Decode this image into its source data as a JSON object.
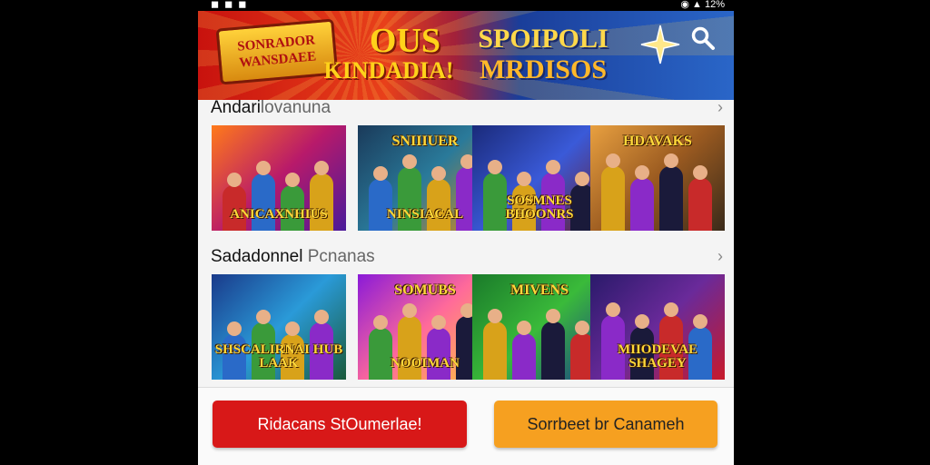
{
  "status_bar": {
    "right_text": "12%"
  },
  "banner": {
    "left_title": "SONRADOR WANSDAEE",
    "mid_title_1": "OUS",
    "mid_title_2": "KINDADIA!",
    "right_title_1": "SPOIPOLI",
    "right_title_2": "MRDISOS"
  },
  "sections": [
    {
      "title_main": "Andari",
      "title_light": "lovanuna",
      "tiles": [
        {
          "top": "",
          "bottom": "ANICAXNHIUS",
          "bg": "linear-gradient(135deg,#ff7a1a,#b81a6a 50%,#4a1a9a)"
        },
        {
          "top": "SNIIIUER",
          "bottom": "NINSIACAL",
          "bg": "linear-gradient(135deg,#1a3a5a,#2a7a9a 50%,#d88a1a)"
        },
        {
          "top": "",
          "bottom": "SOSMNES BHOONRS",
          "bg": "linear-gradient(135deg,#1a2a7a,#3a5ad8 50%,#6a1a2a)"
        },
        {
          "top": "HDAVAKS",
          "bottom": "",
          "bg": "linear-gradient(135deg,#e8a040,#9a5a20 50%,#3a2a1a)"
        }
      ]
    },
    {
      "title_main": "Sadadonnel",
      "title_light": "Pcnanas",
      "tiles": [
        {
          "top": "",
          "bottom": "SHSCALIRNAI HUB LAAK",
          "bg": "linear-gradient(135deg,#1a3a8a,#2a9ad8 50%,#1a5a3a)"
        },
        {
          "top": "SOMUBS",
          "bottom": "NOOIMAN",
          "bg": "linear-gradient(135deg,#8a1ad8,#ff6a9a 50%,#ffc83a)"
        },
        {
          "top": "MIVENS",
          "bottom": "",
          "bg": "linear-gradient(135deg,#1a7a2a,#3aba3a 50%,#1a3a8a)"
        },
        {
          "top": "",
          "bottom": "MIIODEVAE SHAGEY",
          "bg": "linear-gradient(135deg,#2a1a6a,#6a2a9a 50%,#c81a2a)"
        }
      ]
    }
  ],
  "actions": {
    "primary_label": "Ridacans StOumerlae!",
    "secondary_label": "Sorrbeet br Canameh",
    "primary_color": "#d81818",
    "secondary_color": "#f6a020"
  },
  "icons": {
    "search": "search-icon",
    "chevron": "chevron-right-icon"
  }
}
